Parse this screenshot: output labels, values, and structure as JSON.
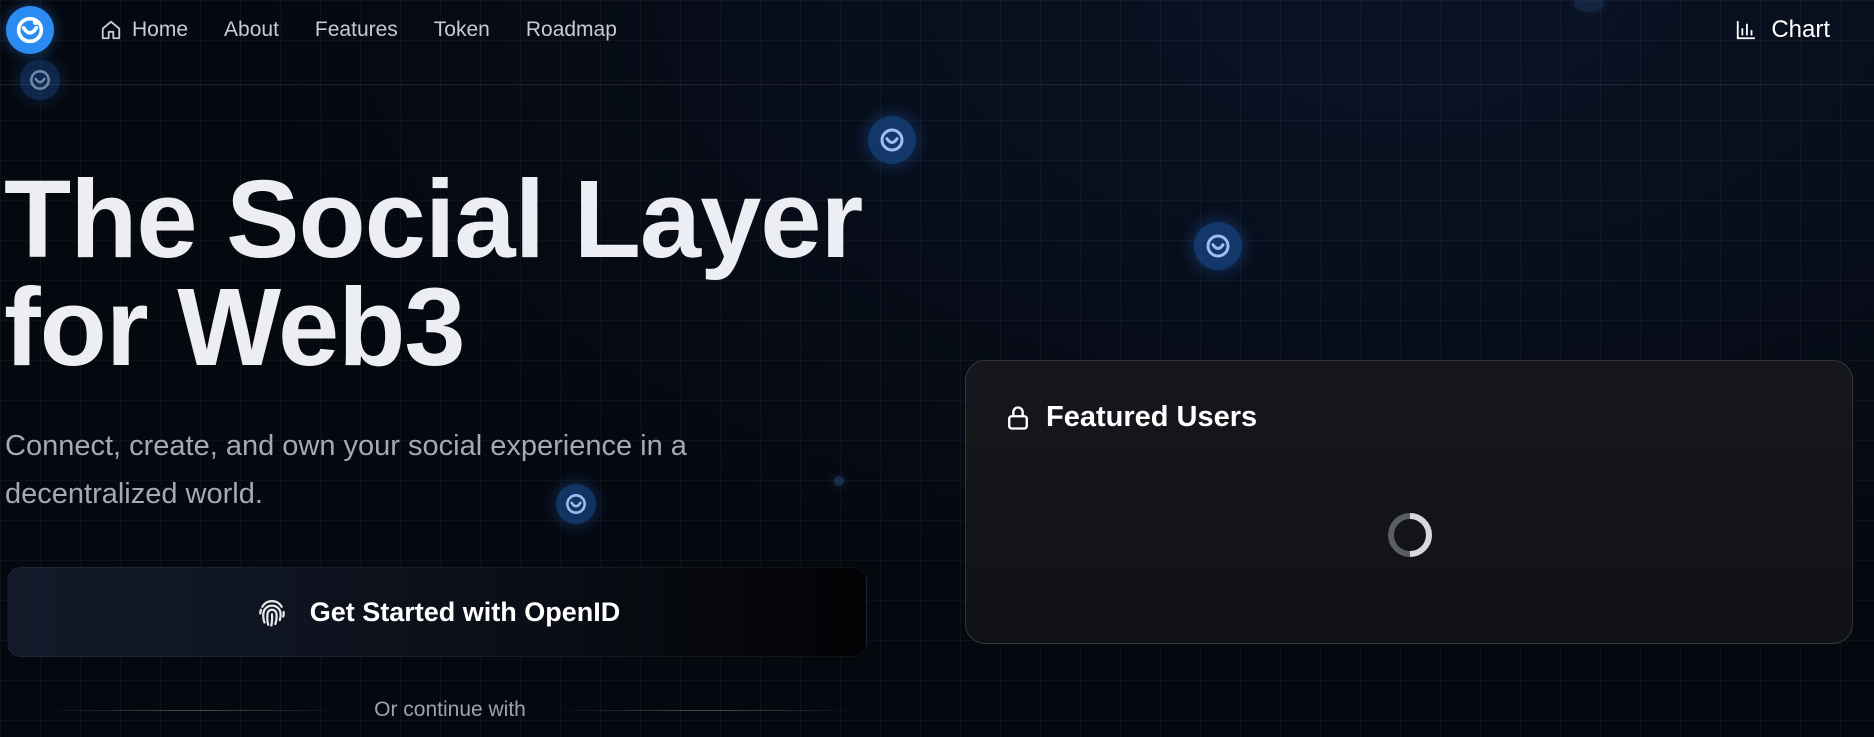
{
  "nav": {
    "items": [
      {
        "label": "Home",
        "icon": "home-icon"
      },
      {
        "label": "About"
      },
      {
        "label": "Features"
      },
      {
        "label": "Token"
      },
      {
        "label": "Roadmap"
      }
    ],
    "chart": {
      "label": "Chart",
      "icon": "bar-chart-icon"
    }
  },
  "hero": {
    "title_line1": "The Social Layer",
    "title_line2": "for Web3",
    "subtitle": "Connect, create, and own your social experience in a decentralized world.",
    "cta_label": "Get Started with OpenID",
    "cta_icon": "fingerprint-icon",
    "divider_text": "Or continue with"
  },
  "featured": {
    "title": "Featured Users",
    "icon": "lock-icon",
    "loading": true
  },
  "colors": {
    "background": "#05080f",
    "accent": "#2a8cf0",
    "card": "#121418"
  }
}
